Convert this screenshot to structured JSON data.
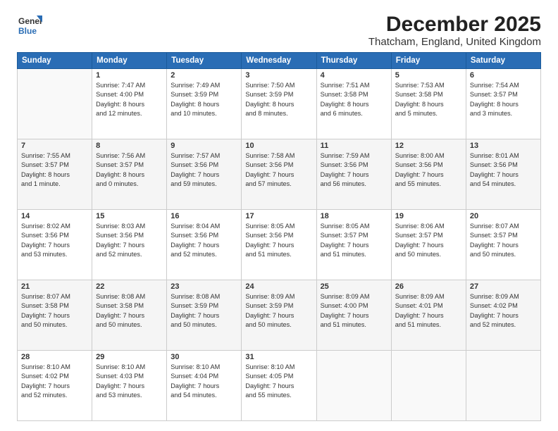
{
  "header": {
    "title": "December 2025",
    "subtitle": "Thatcham, England, United Kingdom"
  },
  "calendar": {
    "headers": [
      "Sunday",
      "Monday",
      "Tuesday",
      "Wednesday",
      "Thursday",
      "Friday",
      "Saturday"
    ],
    "rows": [
      [
        {
          "day": "",
          "info": ""
        },
        {
          "day": "1",
          "info": "Sunrise: 7:47 AM\nSunset: 4:00 PM\nDaylight: 8 hours\nand 12 minutes."
        },
        {
          "day": "2",
          "info": "Sunrise: 7:49 AM\nSunset: 3:59 PM\nDaylight: 8 hours\nand 10 minutes."
        },
        {
          "day": "3",
          "info": "Sunrise: 7:50 AM\nSunset: 3:59 PM\nDaylight: 8 hours\nand 8 minutes."
        },
        {
          "day": "4",
          "info": "Sunrise: 7:51 AM\nSunset: 3:58 PM\nDaylight: 8 hours\nand 6 minutes."
        },
        {
          "day": "5",
          "info": "Sunrise: 7:53 AM\nSunset: 3:58 PM\nDaylight: 8 hours\nand 5 minutes."
        },
        {
          "day": "6",
          "info": "Sunrise: 7:54 AM\nSunset: 3:57 PM\nDaylight: 8 hours\nand 3 minutes."
        }
      ],
      [
        {
          "day": "7",
          "info": "Sunrise: 7:55 AM\nSunset: 3:57 PM\nDaylight: 8 hours\nand 1 minute."
        },
        {
          "day": "8",
          "info": "Sunrise: 7:56 AM\nSunset: 3:57 PM\nDaylight: 8 hours\nand 0 minutes."
        },
        {
          "day": "9",
          "info": "Sunrise: 7:57 AM\nSunset: 3:56 PM\nDaylight: 7 hours\nand 59 minutes."
        },
        {
          "day": "10",
          "info": "Sunrise: 7:58 AM\nSunset: 3:56 PM\nDaylight: 7 hours\nand 57 minutes."
        },
        {
          "day": "11",
          "info": "Sunrise: 7:59 AM\nSunset: 3:56 PM\nDaylight: 7 hours\nand 56 minutes."
        },
        {
          "day": "12",
          "info": "Sunrise: 8:00 AM\nSunset: 3:56 PM\nDaylight: 7 hours\nand 55 minutes."
        },
        {
          "day": "13",
          "info": "Sunrise: 8:01 AM\nSunset: 3:56 PM\nDaylight: 7 hours\nand 54 minutes."
        }
      ],
      [
        {
          "day": "14",
          "info": "Sunrise: 8:02 AM\nSunset: 3:56 PM\nDaylight: 7 hours\nand 53 minutes."
        },
        {
          "day": "15",
          "info": "Sunrise: 8:03 AM\nSunset: 3:56 PM\nDaylight: 7 hours\nand 52 minutes."
        },
        {
          "day": "16",
          "info": "Sunrise: 8:04 AM\nSunset: 3:56 PM\nDaylight: 7 hours\nand 52 minutes."
        },
        {
          "day": "17",
          "info": "Sunrise: 8:05 AM\nSunset: 3:56 PM\nDaylight: 7 hours\nand 51 minutes."
        },
        {
          "day": "18",
          "info": "Sunrise: 8:05 AM\nSunset: 3:57 PM\nDaylight: 7 hours\nand 51 minutes."
        },
        {
          "day": "19",
          "info": "Sunrise: 8:06 AM\nSunset: 3:57 PM\nDaylight: 7 hours\nand 50 minutes."
        },
        {
          "day": "20",
          "info": "Sunrise: 8:07 AM\nSunset: 3:57 PM\nDaylight: 7 hours\nand 50 minutes."
        }
      ],
      [
        {
          "day": "21",
          "info": "Sunrise: 8:07 AM\nSunset: 3:58 PM\nDaylight: 7 hours\nand 50 minutes."
        },
        {
          "day": "22",
          "info": "Sunrise: 8:08 AM\nSunset: 3:58 PM\nDaylight: 7 hours\nand 50 minutes."
        },
        {
          "day": "23",
          "info": "Sunrise: 8:08 AM\nSunset: 3:59 PM\nDaylight: 7 hours\nand 50 minutes."
        },
        {
          "day": "24",
          "info": "Sunrise: 8:09 AM\nSunset: 3:59 PM\nDaylight: 7 hours\nand 50 minutes."
        },
        {
          "day": "25",
          "info": "Sunrise: 8:09 AM\nSunset: 4:00 PM\nDaylight: 7 hours\nand 51 minutes."
        },
        {
          "day": "26",
          "info": "Sunrise: 8:09 AM\nSunset: 4:01 PM\nDaylight: 7 hours\nand 51 minutes."
        },
        {
          "day": "27",
          "info": "Sunrise: 8:09 AM\nSunset: 4:02 PM\nDaylight: 7 hours\nand 52 minutes."
        }
      ],
      [
        {
          "day": "28",
          "info": "Sunrise: 8:10 AM\nSunset: 4:02 PM\nDaylight: 7 hours\nand 52 minutes."
        },
        {
          "day": "29",
          "info": "Sunrise: 8:10 AM\nSunset: 4:03 PM\nDaylight: 7 hours\nand 53 minutes."
        },
        {
          "day": "30",
          "info": "Sunrise: 8:10 AM\nSunset: 4:04 PM\nDaylight: 7 hours\nand 54 minutes."
        },
        {
          "day": "31",
          "info": "Sunrise: 8:10 AM\nSunset: 4:05 PM\nDaylight: 7 hours\nand 55 minutes."
        },
        {
          "day": "",
          "info": ""
        },
        {
          "day": "",
          "info": ""
        },
        {
          "day": "",
          "info": ""
        }
      ]
    ]
  }
}
